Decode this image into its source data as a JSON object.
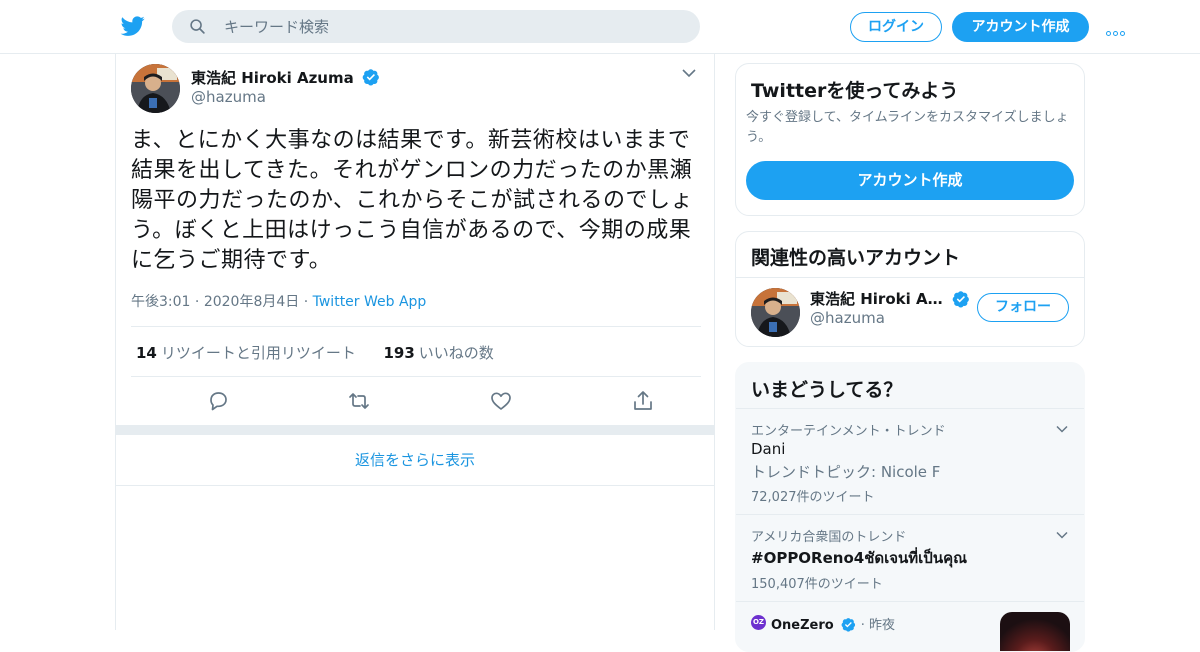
{
  "header": {
    "search_placeholder": "キーワード検索",
    "login_label": "ログイン",
    "signup_label": "アカウント作成"
  },
  "tweet": {
    "author_name": "東浩紀 Hiroki Azuma",
    "author_handle": "@hazuma",
    "text": "ま、とにかく大事なのは結果です。新芸術校はいままで結果を出してきた。それがゲンロンの力だったのか黒瀬陽平の力だったのか、これからそこが試されるのでしょう。ぼくと上田はけっこう自信があるので、今期の成果に乞うご期待です。",
    "time": "午後3:01",
    "date": "2020年8月4日",
    "source": "Twitter Web App",
    "retweet_count": "14",
    "retweet_label": "リツイートと引用リツイート",
    "like_count": "193",
    "like_label": "いいねの数"
  },
  "show_more_replies": "返信をさらに表示",
  "signup_card": {
    "title": "Twitterを使ってみよう",
    "description": "今すぐ登録して、タイムラインをカスタマイズしましょう。",
    "button": "アカウント作成"
  },
  "related": {
    "title": "関連性の高いアカウント",
    "name": "東浩紀 Hiroki Azu...",
    "handle": "@hazuma",
    "follow_label": "フォロー"
  },
  "trends": {
    "title": "いまどうしてる？",
    "items": [
      {
        "context": "エンターテインメント・トレンド",
        "name": "Dani",
        "subtitle": "トレンドトピック: Nicole F",
        "count": "72,027件のツイート"
      },
      {
        "context": "アメリカ合衆国のトレンド",
        "name": "#OPPOReno4ชัดเจนที่เป็นคุณ",
        "count": "150,407件のツイート"
      }
    ],
    "news": {
      "logo_text": "OZ",
      "source": "OneZero",
      "time": "昨夜"
    }
  },
  "colors": {
    "accent": "#1da1f2",
    "link": "#1b95e0",
    "secondary_text": "#657786",
    "border": "#e6ecf0"
  },
  "icons": [
    "twitter-bird-icon",
    "search-icon",
    "more-icon",
    "verified-icon",
    "chevron-down-icon",
    "reply-icon",
    "retweet-icon",
    "like-icon",
    "share-icon"
  ]
}
